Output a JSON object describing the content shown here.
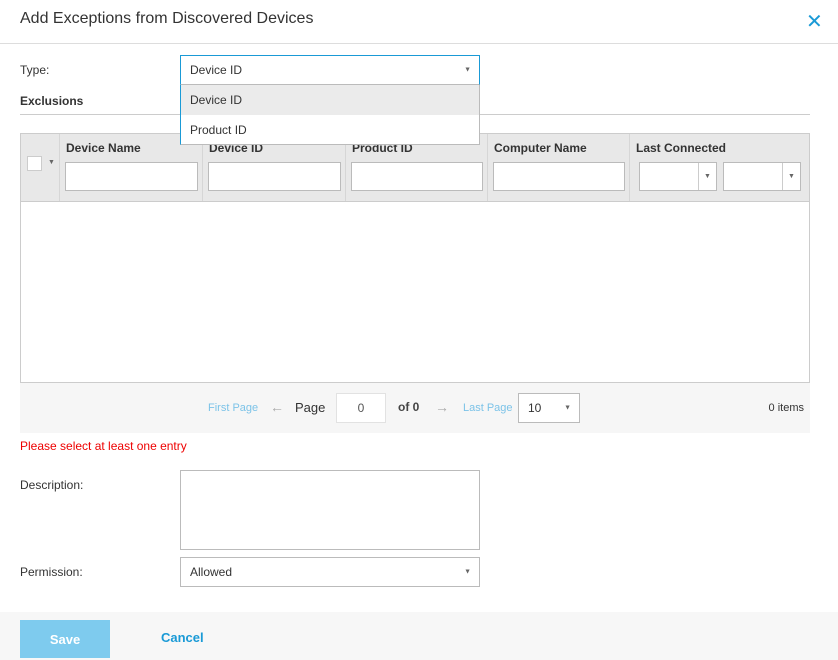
{
  "dialog": {
    "title": "Add Exceptions from Discovered Devices",
    "close_icon": "close-icon"
  },
  "type": {
    "label": "Type:",
    "value": "Device ID",
    "options": [
      "Device ID",
      "Product ID"
    ],
    "highlighted": "Device ID"
  },
  "exclusions": {
    "heading": "Exclusions",
    "columns": [
      "Device Name",
      "Device ID",
      "Product ID",
      "Computer Name",
      "Last Connected"
    ],
    "rows": []
  },
  "pager": {
    "first": "First Page",
    "page_label": "Page",
    "page_value": "0",
    "of": "of 0",
    "last": "Last Page",
    "page_size": "10",
    "items": "0 items"
  },
  "error": "Please select at least one entry",
  "description": {
    "label": "Description:",
    "value": ""
  },
  "permission": {
    "label": "Permission:",
    "value": "Allowed"
  },
  "footer": {
    "save": "Save",
    "cancel": "Cancel"
  },
  "colors": {
    "accent": "#1a9ad6",
    "save_button": "#7ecbee",
    "error": "#ee0000"
  }
}
